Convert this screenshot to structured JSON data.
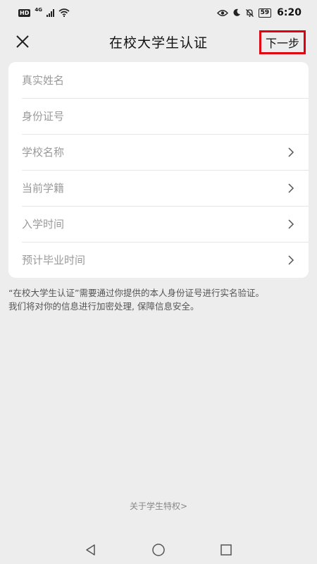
{
  "status_bar": {
    "hd_label": "HD",
    "network_label": "4G",
    "battery": "59",
    "time": "6:20"
  },
  "header": {
    "title": "在校大学生认证",
    "next_label": "下一步"
  },
  "form": {
    "name_placeholder": "真实姓名",
    "id_placeholder": "身份证号",
    "school_label": "学校名称",
    "status_label": "当前学籍",
    "enroll_label": "入学时间",
    "graduate_label": "预计毕业时间"
  },
  "notice": {
    "line1": "“在校大学生认证”需要通过你提供的本人身份证号进行实名验证。",
    "line2": "我们将对你的信息进行加密处理, 保障信息安全。"
  },
  "footer": {
    "about_link": "关于学生特权>"
  },
  "icons": {
    "close": "close-icon",
    "chevron": "chevron-right-icon",
    "back": "back-triangle-icon",
    "home": "home-circle-icon",
    "recents": "recents-square-icon"
  },
  "colors": {
    "highlight": "#e0000f",
    "background": "#ededed",
    "card": "#ffffff",
    "placeholder": "#9a9a9a"
  }
}
